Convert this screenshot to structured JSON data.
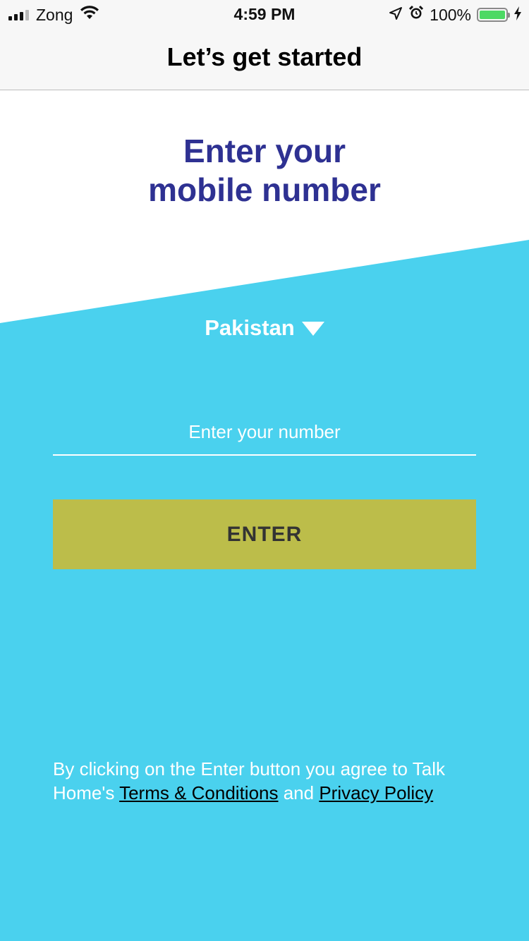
{
  "status_bar": {
    "carrier": "Zong",
    "time": "4:59 PM",
    "battery_percent": "100%",
    "battery_level": 1.0,
    "signal_bars_filled": 3,
    "signal_bars_total": 4,
    "icons": [
      "signal-icon",
      "wifi-icon",
      "location-arrow-icon",
      "alarm-clock-icon",
      "battery-icon",
      "charging-bolt-icon"
    ]
  },
  "nav": {
    "title": "Let’s get started"
  },
  "heading": {
    "line1": "Enter your",
    "line2": "mobile number"
  },
  "country_selector": {
    "value": "Pakistan",
    "icon": "triangle-down-icon"
  },
  "number_input": {
    "value": "",
    "placeholder": "Enter your number"
  },
  "enter_button": {
    "label": "ENTER"
  },
  "terms": {
    "prefix": "By clicking on the Enter button you agree to Talk Home's ",
    "terms_link": "Terms & Conditions",
    "middle": " and ",
    "privacy_link": "Privacy Policy"
  },
  "colors": {
    "heading": "#2e3192",
    "accent_background": "#4ad1ee",
    "button": "#bcbd4a",
    "battery_fill": "#4cd964"
  }
}
